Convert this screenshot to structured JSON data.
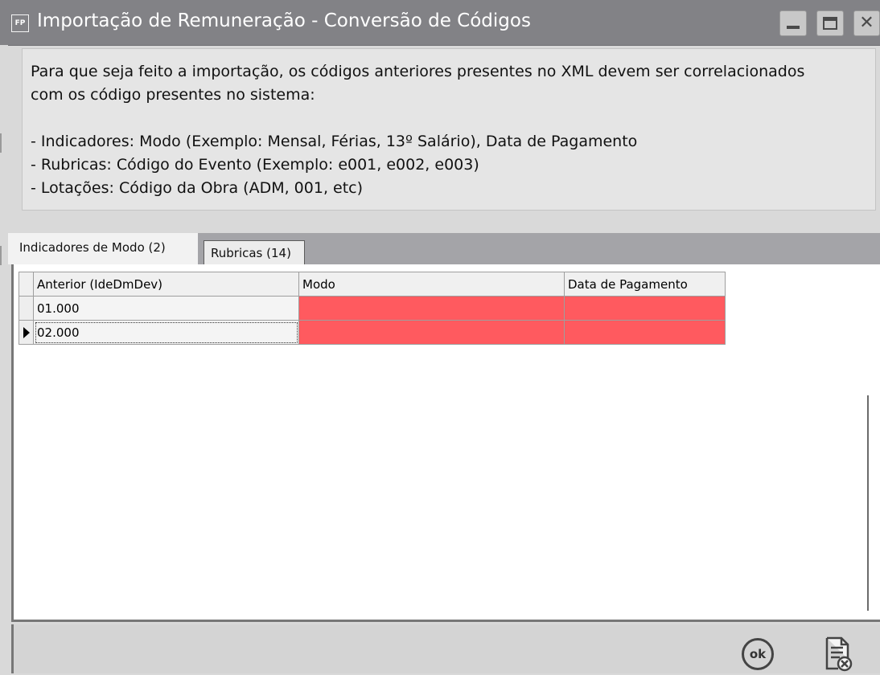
{
  "window": {
    "app_icon": "FP",
    "title": "Importação de Remuneração - Conversão de Códigos",
    "min_icon": "minimize-icon",
    "max_icon": "maximize-icon",
    "close_icon": "close-icon"
  },
  "info": {
    "lines": [
      "Para que seja feito a importação, os códigos anteriores presentes no XML devem ser correlacionados",
      "com os código presentes no sistema:",
      "",
      "- Indicadores: Modo (Exemplo: Mensal, Férias, 13º Salário), Data de Pagamento",
      "- Rubricas: Código do Evento (Exemplo: e001, e002, e003)",
      "- Lotações: Código da Obra (ADM, 001, etc)"
    ]
  },
  "tabs": [
    {
      "label": "Indicadores de Modo (2)",
      "active": true
    },
    {
      "label": "Rubricas (14)",
      "active": false
    }
  ],
  "grid": {
    "columns": [
      "Anterior (IdeDmDev)",
      "Modo",
      "Data de Pagamento"
    ],
    "rows": [
      {
        "anterior": "01.000",
        "modo": "",
        "data_pagamento": "",
        "current": false
      },
      {
        "anterior": "02.000",
        "modo": "",
        "data_pagamento": "",
        "current": true
      }
    ],
    "missing_value_color": "#ff5a5f"
  },
  "footer": {
    "ok_label": "ok",
    "ok_icon": "ok-icon",
    "cancel_icon": "cancel-document-icon"
  }
}
